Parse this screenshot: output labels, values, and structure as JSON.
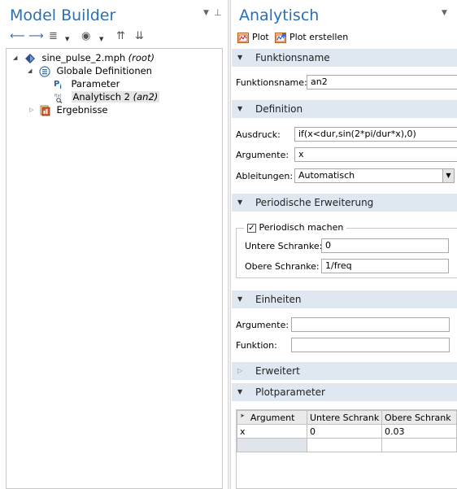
{
  "model_builder": {
    "title": "Model Builder",
    "tree": {
      "root": {
        "name": "sine_pulse_2.mph",
        "suffix": "(root)"
      },
      "global_definitions": "Globale Definitionen",
      "parameters": "Parameter",
      "analytic": {
        "name": "Analytisch 2",
        "suffix": "(an2)"
      },
      "results": "Ergebnisse"
    }
  },
  "settings": {
    "title": "Analytisch",
    "toolbar": {
      "plot": "Plot",
      "create_plot": "Plot erstellen"
    },
    "sections": {
      "function_name": {
        "title": "Funktionsname",
        "label": "Funktionsname:",
        "value": "an2"
      },
      "definition": {
        "title": "Definition",
        "expression_label": "Ausdruck:",
        "expression_value": "if(x<dur,sin(2*pi/dur*x),0)",
        "arguments_label": "Argumente:",
        "arguments_value": "x",
        "derivatives_label": "Ableitungen:",
        "derivatives_value": "Automatisch"
      },
      "periodic": {
        "title": "Periodische Erweiterung",
        "checkbox_label": "Periodisch machen",
        "checked": true,
        "lower_label": "Untere Schranke:",
        "lower_value": "0",
        "upper_label": "Obere Schranke:",
        "upper_value": "1/freq"
      },
      "units": {
        "title": "Einheiten",
        "arguments_label": "Argumente:",
        "arguments_value": "",
        "function_label": "Funktion:",
        "function_value": ""
      },
      "advanced": {
        "title": "Erweitert"
      },
      "plot_parameters": {
        "title": "Plotparameter",
        "columns": [
          "Argument",
          "Untere Schrank",
          "Obere Schrank"
        ],
        "rows": [
          [
            "x",
            "0",
            "0.03"
          ],
          [
            "",
            "",
            ""
          ]
        ]
      }
    }
  }
}
